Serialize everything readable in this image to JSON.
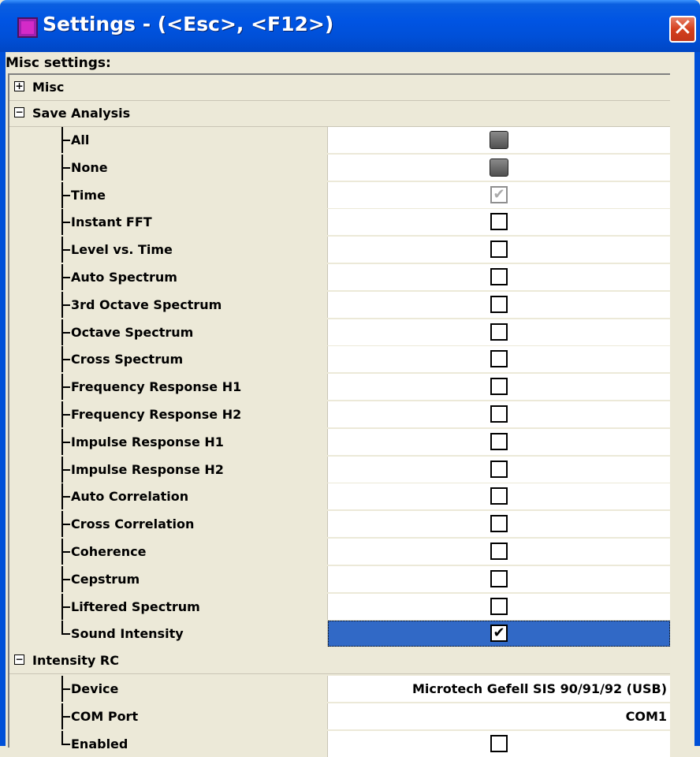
{
  "window": {
    "title": "Settings - (<Esc>, <F12>)",
    "close_glyph": "✕",
    "icon": "app-icon"
  },
  "section_caption": "Misc settings:",
  "categories": {
    "misc": {
      "label": "Misc",
      "state": "+"
    },
    "save_analysis": {
      "label": "Save Analysis",
      "state": "−"
    },
    "intensity_rc": {
      "label": "Intensity RC",
      "state": "−"
    }
  },
  "save_analysis_items": [
    {
      "label": "All",
      "control": "button"
    },
    {
      "label": "None",
      "control": "button"
    },
    {
      "label": "Time",
      "control": "checkbox",
      "checked": true,
      "disabled": true
    },
    {
      "label": "Instant FFT",
      "control": "checkbox",
      "checked": false
    },
    {
      "label": "Level vs. Time",
      "control": "checkbox",
      "checked": false
    },
    {
      "label": "Auto Spectrum",
      "control": "checkbox",
      "checked": false
    },
    {
      "label": "3rd Octave Spectrum",
      "control": "checkbox",
      "checked": false
    },
    {
      "label": "Octave Spectrum",
      "control": "checkbox",
      "checked": false
    },
    {
      "label": "Cross Spectrum",
      "control": "checkbox",
      "checked": false
    },
    {
      "label": "Frequency Response H1",
      "control": "checkbox",
      "checked": false
    },
    {
      "label": "Frequency Response H2",
      "control": "checkbox",
      "checked": false
    },
    {
      "label": "Impulse Response H1",
      "control": "checkbox",
      "checked": false
    },
    {
      "label": "Impulse Response H2",
      "control": "checkbox",
      "checked": false
    },
    {
      "label": "Auto Correlation",
      "control": "checkbox",
      "checked": false
    },
    {
      "label": "Cross Correlation",
      "control": "checkbox",
      "checked": false
    },
    {
      "label": "Coherence",
      "control": "checkbox",
      "checked": false
    },
    {
      "label": "Cepstrum",
      "control": "checkbox",
      "checked": false
    },
    {
      "label": "Liftered Spectrum",
      "control": "checkbox",
      "checked": false
    },
    {
      "label": "Sound Intensity",
      "control": "checkbox",
      "checked": true,
      "selected": true
    }
  ],
  "intensity_rc_items": [
    {
      "label": "Device",
      "control": "text",
      "value": "Microtech Gefell SIS 90/91/92 (USB)"
    },
    {
      "label": "COM Port",
      "control": "text",
      "value": "COM1"
    },
    {
      "label": "Enabled",
      "control": "checkbox",
      "checked": false
    }
  ],
  "check_glyph": "✔",
  "colors": {
    "selection": "#3169c6",
    "titlebar": "#0054e3",
    "close": "#d4401e"
  }
}
